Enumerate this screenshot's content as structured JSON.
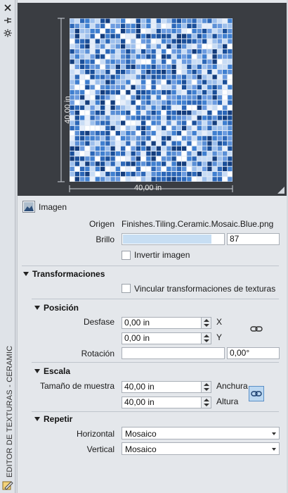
{
  "sidebar": {
    "title": "EDITOR DE TEXTURAS - CERAMIC",
    "close_icon": "close-icon",
    "pin_icon": "pin-icon",
    "settings_icon": "settings-icon"
  },
  "preview": {
    "width_dim": "40,00 in",
    "height_dim": "40,00 in",
    "tile_colors": [
      "#1a4f9a",
      "#2c67b8",
      "#3f7fd0",
      "#6b9be0",
      "#9dbfec",
      "#c8dcf5",
      "#e6eefa",
      "#ffffff",
      "#143d7d",
      "#5a8fd6"
    ]
  },
  "image_section": {
    "label": "Imagen",
    "origin_label": "Origen",
    "origin_value": "Finishes.Tiling.Ceramic.Mosaic.Blue.png",
    "brightness_label": "Brillo",
    "brightness_value": "87",
    "brightness_fraction": 0.87,
    "invert_label": "Invertir imagen",
    "invert_checked": false
  },
  "transformations": {
    "header": "Transformaciones",
    "link_label": "Vincular transformaciones de texturas",
    "link_checked": false,
    "position": {
      "header": "Posición",
      "offset_label": "Desfase",
      "offset_x": "0,00 in",
      "offset_y": "0,00 in",
      "x_label": "X",
      "y_label": "Y",
      "rotation_label": "Rotación",
      "rotation_value": "",
      "rotation_deg": "0,00°"
    },
    "scale": {
      "header": "Escala",
      "sample_size_label": "Tamaño de muestra",
      "width_value": "40,00 in",
      "height_value": "40,00 in",
      "width_label": "Anchura",
      "height_label": "Altura"
    },
    "repeat": {
      "header": "Repetir",
      "horizontal_label": "Horizontal",
      "horizontal_value": "Mosaico",
      "vertical_label": "Vertical",
      "vertical_value": "Mosaico"
    }
  }
}
